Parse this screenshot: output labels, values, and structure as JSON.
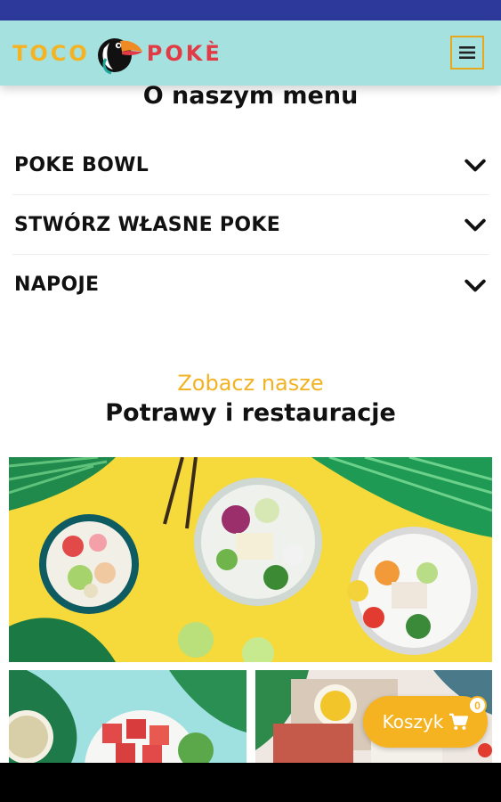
{
  "brand": {
    "left": "TOCO",
    "right": "POKÈ"
  },
  "header": {
    "menu_icon": "hamburger-icon"
  },
  "menu_section": {
    "title": "O naszym menu",
    "items": [
      {
        "label": "POKE BOWL",
        "icon": "chevron-down-icon"
      },
      {
        "label": "STWÓRZ WŁASNE POKE",
        "icon": "chevron-down-icon"
      },
      {
        "label": "NAPOJE",
        "icon": "chevron-down-icon"
      }
    ]
  },
  "gallery": {
    "subtitle": "Zobacz nasze",
    "title": "Potrawy i restauracje"
  },
  "cart": {
    "label": "Koszyk",
    "count": "0",
    "icon": "cart-icon"
  },
  "colors": {
    "status_bar": "#2d3a9c",
    "header_bg": "#a5e2df",
    "accent": "#f5b321",
    "brand_red": "#e23b45"
  }
}
